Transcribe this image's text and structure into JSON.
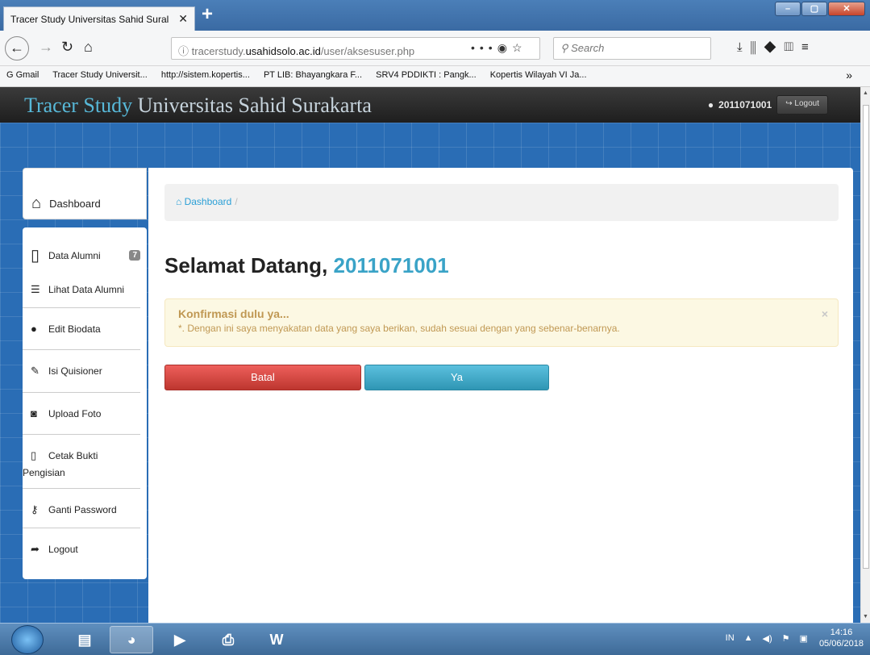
{
  "browser": {
    "tab_title": "Tracer Study Universitas Sahid Sural",
    "url_prefix": "tracerstudy.",
    "url_host": "usahidsolo.ac.id",
    "url_path": "/user/aksesuser.php",
    "search_placeholder": "Search",
    "bookmarks": [
      "G Gmail",
      "Tracer Study Universit...",
      "http://sistem.kopertis...",
      "PT LIB: Bhayangkara F...",
      "SRV4 PDDIKTI : Pangk...",
      "Kopertis Wilayah VI Ja..."
    ]
  },
  "site": {
    "brand_prefix": "Tracer Study",
    "brand_rest": " Universitas Sahid Surakarta",
    "username": "2011071001",
    "logout_top": "Logout"
  },
  "sidebar": {
    "dashboard": "Dashboard",
    "data_alumni": "Data Alumni",
    "data_alumni_badge": "7",
    "items": [
      {
        "label": "Lihat Data Alumni",
        "icon": "list-icon"
      },
      {
        "label": "Edit Biodata",
        "icon": "user-icon"
      },
      {
        "label": "Isi Quisioner",
        "icon": "edit-icon"
      },
      {
        "label": "Upload Foto",
        "icon": "camera-icon"
      },
      {
        "label_1": "Cetak Bukti",
        "label_2": "Pengisian",
        "icon": "file-icon"
      },
      {
        "label": "Ganti Password",
        "icon": "key-icon"
      },
      {
        "label": "Logout",
        "icon": "share-icon"
      }
    ]
  },
  "main": {
    "breadcrumb": "Dashboard",
    "breadcrumb_sep": "/",
    "welcome_prefix": "Selamat Datang, ",
    "welcome_user": "2011071001",
    "alert_title": "Konfirmasi dulu ya...",
    "alert_text": "*. Dengan ini saya menyakatan data yang saya berikan, sudah sesuai dengan yang sebenar-benarnya.",
    "alert_close": "×",
    "btn_batal": "Batal",
    "btn_ya": "Ya"
  },
  "taskbar": {
    "lang": "IN",
    "time": "14:16",
    "date": "05/06/2018"
  }
}
